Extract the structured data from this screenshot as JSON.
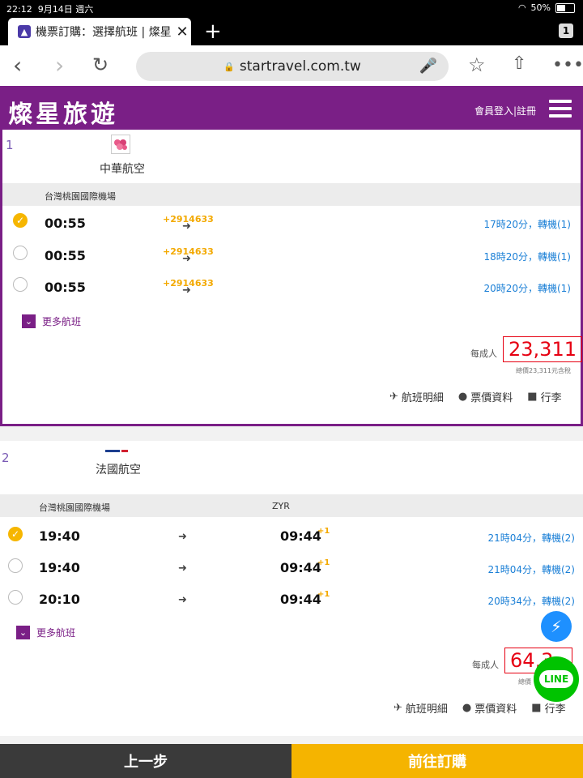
{
  "status": {
    "time": "22:12",
    "date": "9月14日 週六",
    "battery": "50%"
  },
  "tab": {
    "title": "機票訂購：選擇航班 | 燦星",
    "count": "1"
  },
  "url": "startravel.com.tw",
  "site": {
    "logo": "燦星旅遊",
    "login": "會員登入|註冊"
  },
  "results": [
    {
      "index": "1",
      "airline": "中華航空",
      "origin": "台灣桃園國際機場",
      "destination": "",
      "flights": [
        {
          "selected": true,
          "depart": "00:55",
          "code": "+2914633",
          "arrive": "",
          "plus": "",
          "duration": "17時20分，轉機(1)"
        },
        {
          "selected": false,
          "depart": "00:55",
          "code": "+2914633",
          "arrive": "",
          "plus": "",
          "duration": "18時20分，轉機(1)"
        },
        {
          "selected": false,
          "depart": "00:55",
          "code": "+2914633",
          "arrive": "",
          "plus": "",
          "duration": "20時20分，轉機(1)"
        }
      ],
      "more": "更多航班",
      "per_adult": "每成人",
      "price": "23,311",
      "total": "總價23,311元含稅",
      "links": {
        "detail": "航班明細",
        "fare": "票價資料",
        "baggage": "行李"
      }
    },
    {
      "index": "2",
      "airline": "法國航空",
      "origin": "台灣桃園國際機場",
      "destination": "ZYR",
      "flights": [
        {
          "selected": true,
          "depart": "19:40",
          "code": "",
          "arrive": "09:44",
          "plus": "+1",
          "duration": "21時04分，轉機(2)"
        },
        {
          "selected": false,
          "depart": "19:40",
          "code": "",
          "arrive": "09:44",
          "plus": "+1",
          "duration": "21時04分，轉機(2)"
        },
        {
          "selected": false,
          "depart": "20:10",
          "code": "",
          "arrive": "09:44",
          "plus": "+1",
          "duration": "20時34分，轉機(2)"
        }
      ],
      "more": "更多航班",
      "per_adult": "每成人",
      "price": "64,3",
      "total": "總價",
      "links": {
        "detail": "航班明細",
        "fare": "票價資料",
        "baggage": "行李"
      }
    }
  ],
  "footer": {
    "prev": "上一步",
    "next": "前往訂購"
  },
  "floating": {
    "line": "LINE"
  }
}
